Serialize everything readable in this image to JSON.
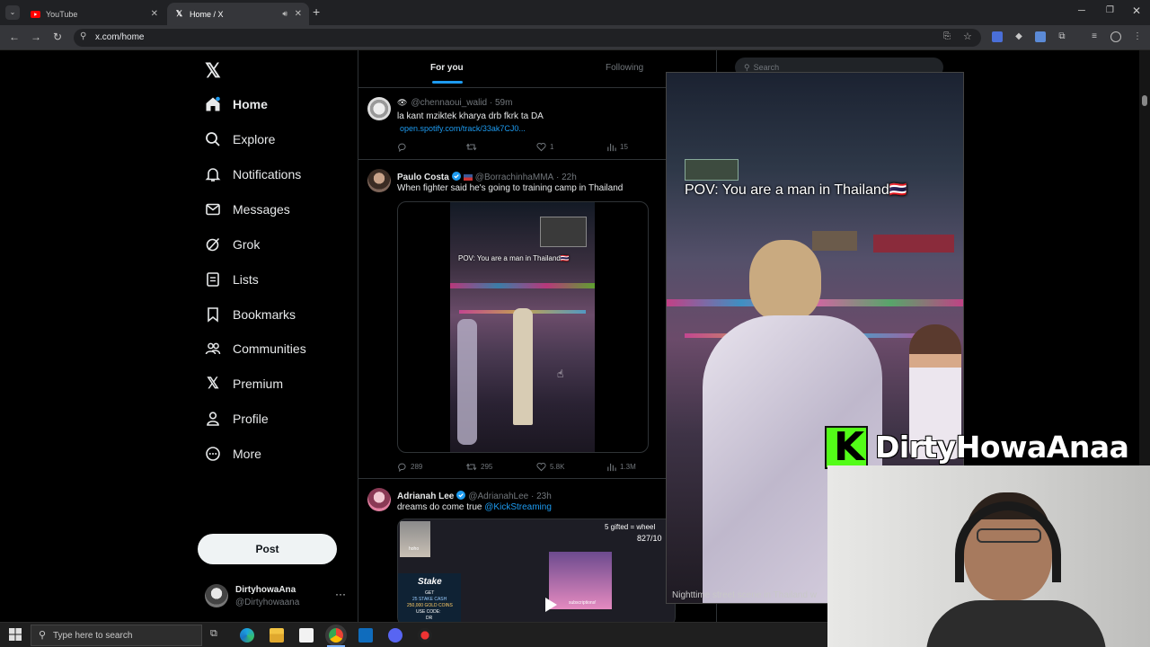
{
  "browser": {
    "tabs": [
      {
        "title": "YouTube",
        "active": false
      },
      {
        "title": "Home / X",
        "active": true
      }
    ],
    "url": "x.com/home"
  },
  "nav": {
    "items": [
      {
        "label": "Home",
        "icon": "home-icon"
      },
      {
        "label": "Explore",
        "icon": "search-icon"
      },
      {
        "label": "Notifications",
        "icon": "bell-icon"
      },
      {
        "label": "Messages",
        "icon": "mail-icon"
      },
      {
        "label": "Grok",
        "icon": "grok-icon"
      },
      {
        "label": "Lists",
        "icon": "list-icon"
      },
      {
        "label": "Bookmarks",
        "icon": "bookmark-icon"
      },
      {
        "label": "Communities",
        "icon": "people-icon"
      },
      {
        "label": "Premium",
        "icon": "x-icon"
      },
      {
        "label": "Profile",
        "icon": "person-icon"
      },
      {
        "label": "More",
        "icon": "more-circle-icon"
      }
    ],
    "post_label": "Post",
    "account": {
      "name": "DirtyhowaAna",
      "handle": "@Dirtyhowaana"
    }
  },
  "timeline": {
    "tabs": {
      "for_you": "For you",
      "following": "Following"
    },
    "posts": [
      {
        "handle": "@chennaoui_walid",
        "time": "59m",
        "text": "la kant mziktek kharya drb fkrk ta DA",
        "link": "open.spotify.com/track/33ak7CJ0...",
        "replies": "",
        "reposts": "",
        "likes": "1",
        "views": "15"
      },
      {
        "name": "Paulo Costa",
        "handle": "@BorrachinhaMMA",
        "time": "22h",
        "text": "When  fighter said he's going to training camp in Thailand",
        "video_caption": "POV: You are a man in Thailand🇹🇭",
        "replies": "289",
        "reposts": "295",
        "likes": "5.8K",
        "views": "1.3M"
      },
      {
        "name": "Adrianah Lee",
        "handle": "@AdrianahLee",
        "time": "23h",
        "text": "dreams do come true",
        "mention": "@KickStreaming",
        "media_top_text": "5 gifted = wheel",
        "media_counter": "827/10",
        "media_label": "hoho",
        "stake": {
          "brand": "Stake",
          "get": "GET",
          "cash": "25 STAKE CASH",
          "coins": "250,000 GOLD COINS",
          "code": "USE CODE:",
          "code_val": "DR"
        },
        "media_sub": "subscriptions!"
      }
    ]
  },
  "right": {
    "search_placeholder": "Search"
  },
  "popup_video": {
    "caption": "POV: You are a man in Thailand🇹🇭",
    "description": "Nighttime street scene in Thailand w"
  },
  "stream_overlay": {
    "channel_name": "DirtyHowaAnaa",
    "kick_letter": "K"
  },
  "taskbar": {
    "search_placeholder": "Type here to search"
  }
}
